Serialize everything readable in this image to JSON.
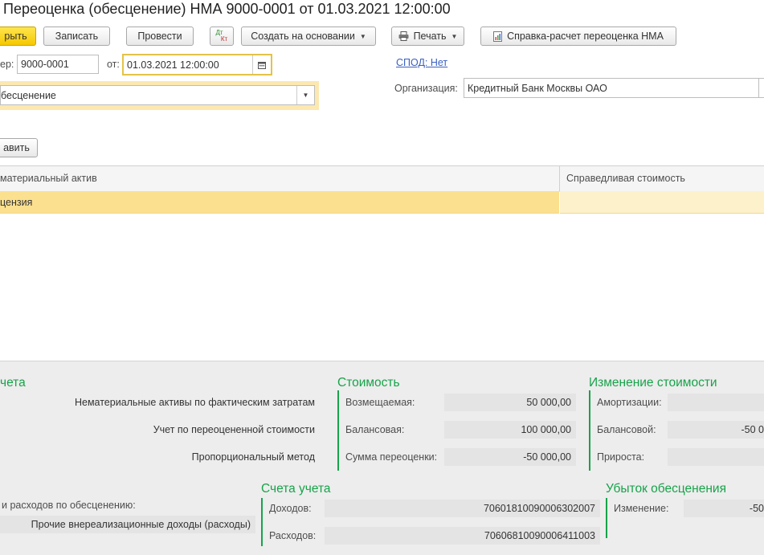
{
  "window": {
    "title": "Переоценка (обесценение) НМА 9000-0001 от 01.03.2021 12:00:00"
  },
  "toolbar": {
    "post_close": "рыть",
    "write": "Записать",
    "post": "Провести",
    "dtkt_top": "Дт",
    "dtkt_bottom": "Кт",
    "create_based_on": "Создать на основании",
    "print": "Печать",
    "report": "Справка-расчет переоценка НМА"
  },
  "header": {
    "number_label": "ер:",
    "number_value": "9000-0001",
    "date_label": "от:",
    "date_value": "01.03.2021 12:00:00",
    "spod_link": "СПОД: Нет",
    "operation_value": "бесценение",
    "org_label": "Организация:",
    "org_value": "Кредитный Банк Москвы ОАО"
  },
  "table": {
    "add_button": "авить",
    "col_asset": "материальный актив",
    "col_fair_value": "Справедливая стоимость",
    "rows": [
      {
        "asset": "цензия",
        "fair_value": ""
      }
    ]
  },
  "bottom": {
    "accounting": {
      "title": "чета",
      "values": [
        "Нематериальные активы по фактическим затратам",
        "Учет по переоцененной стоимости",
        "Пропорциональный метод"
      ]
    },
    "cost": {
      "title": "Стоимость",
      "rows": [
        {
          "label": "Возмещаемая:",
          "value": "50 000,00"
        },
        {
          "label": "Балансовая:",
          "value": "100 000,00"
        },
        {
          "label": "Сумма переоценки:",
          "value": "-50 000,00"
        }
      ]
    },
    "change": {
      "title": "Изменение стоимости",
      "rows": [
        {
          "label": "Амортизации:",
          "value": ""
        },
        {
          "label": "Балансовой:",
          "value": "-50 0"
        },
        {
          "label": "Прироста:",
          "value": ""
        }
      ]
    },
    "income_expense": {
      "label": "и расходов по обесценению:",
      "value": "Прочие внереализационные доходы (расходы)"
    },
    "accounts": {
      "title": "Счета учета",
      "rows": [
        {
          "label": "Доходов:",
          "value": "70601810090006302007"
        },
        {
          "label": "Расходов:",
          "value": "70606810090006411003"
        }
      ]
    },
    "impairment": {
      "title": "Убыток обесценения",
      "rows": [
        {
          "label": "Изменение:",
          "value": "-50"
        }
      ]
    }
  }
}
